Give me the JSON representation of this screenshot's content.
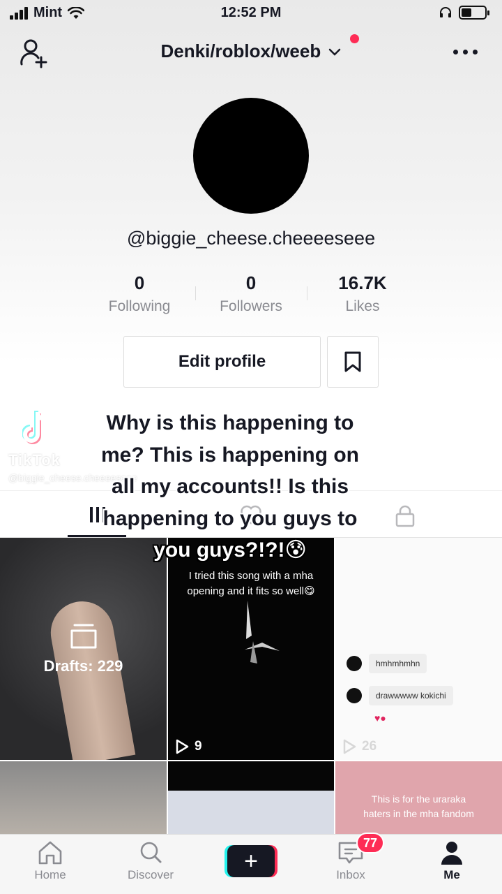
{
  "status_bar": {
    "carrier": "Mint",
    "time": "12:52 PM",
    "battery_level": 0.45
  },
  "header": {
    "title": "Denki/roblox/weeb",
    "icons": [
      "add-friend-icon",
      "chevron-down-icon",
      "notification-dot",
      "more-icon"
    ]
  },
  "profile": {
    "username": "@biggie_cheese.cheeeeseee",
    "stats": [
      {
        "value": "0",
        "label": "Following"
      },
      {
        "value": "0",
        "label": "Followers"
      },
      {
        "value": "16.7K",
        "label": "Likes"
      }
    ],
    "edit_label": "Edit profile"
  },
  "watermark": {
    "brand": "TikTok",
    "user": "@biggie_cheese.cheeeeseee"
  },
  "overlay": {
    "lines": [
      "Why is this happening to",
      "me? This is happening on",
      "all my accounts!!  Is this",
      "happening to you guys to"
    ],
    "last_line": "you guys?!?!😰"
  },
  "tabs": [
    "videos-grid-icon",
    "liked-heart-icon",
    "private-lock-icon"
  ],
  "grid": {
    "drafts_label": "Drafts: 229",
    "video2_caption_1": "I tried this song with a mha",
    "video2_caption_2": "opening and it fits so well😋",
    "video2_plays": "9",
    "video3_chat_1": "hmhmhmhn",
    "video3_chat_2": "drawwwww kokichi",
    "video3_plays": "26",
    "video6_caption_1": "This is for the uraraka",
    "video6_caption_2": "haters in the mha fandom"
  },
  "bottom_nav": {
    "home": "Home",
    "discover": "Discover",
    "inbox": "Inbox",
    "me": "Me",
    "inbox_badge": "77"
  },
  "colors": {
    "accent_red": "#fe2c55",
    "accent_cyan": "#25f4ee",
    "text_dark": "#161823",
    "text_muted": "#8a8b91"
  }
}
